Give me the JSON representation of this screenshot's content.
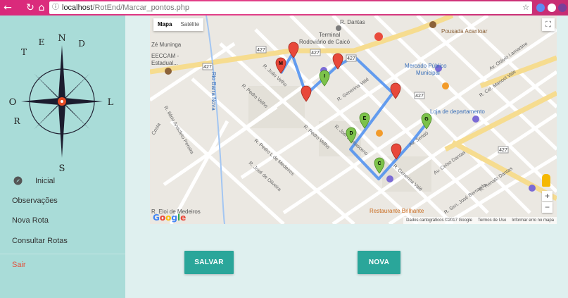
{
  "browser": {
    "url_host": "localhost",
    "url_path": "/RotEnd/Marcar_pontos.php"
  },
  "sidebar": {
    "logo_letters": {
      "n": "N",
      "e": "E",
      "s": "S",
      "o": "O",
      "l": "L",
      "r": "R",
      "t": "T",
      "d": "D"
    },
    "items": [
      {
        "label": "Inicial",
        "icon": "compass-icon"
      },
      {
        "label": "Observações"
      },
      {
        "label": "Nova Rota"
      },
      {
        "label": "Consultar Rotas"
      },
      {
        "label": "Sair"
      }
    ],
    "colors": {
      "background": "#a9dcd8",
      "sair": "#e2513c"
    }
  },
  "map": {
    "type_buttons": [
      "Mapa",
      "Satélite"
    ],
    "selected_type": "Mapa",
    "labels": {
      "terminal": "Terminal",
      "rodoviario": "Rodoviário de Caicó",
      "ze_muninga": "Zé Muninga",
      "eeccam": "EECCAM -",
      "estadual": "Estadual...",
      "rio": "Rio Barra Nova",
      "mercado1": "Mercado Público",
      "mercado2": "Municipal",
      "pousada": "Pousada Acantoar",
      "loja": "Loja de departamento",
      "restaurante": "Restaurante Brilhante",
      "eloi": "R. Eloi de Medeiros",
      "dantas": "R. Dantas",
      "pedro_velho1": "R. Pedro Velho",
      "pedro_velho2": "R. Pedro Velho",
      "joao_velho": "R. João Velho",
      "pedro_medeiros": "R. Pedro L de Medeiros",
      "jose_oliveira": "R. José de Oliveira",
      "generina": "R. Generina Valé",
      "generina2": "R. Generina Valé",
      "joel": "R. Joel Damasceno",
      "celso": "Av. Celso Dantas",
      "seridó": "Av. Seridó",
      "renato": "R. Renato Dantas",
      "teofilo": "R. Sen. José Bernardo",
      "lamartine": "Av. Otávio Lamartine",
      "cel_manoel": "R. Cel. Manoel Vale",
      "anacio": "R. Ilário Anacleto Pereira",
      "costa": "Costa",
      "route_327": "427",
      "route_428": "427"
    },
    "markers": [
      {
        "label": "M",
        "color": "red"
      },
      {
        "label": "",
        "color": "red"
      },
      {
        "label": "",
        "color": "red"
      },
      {
        "label": "I",
        "color": "green"
      },
      {
        "label": "",
        "color": "red"
      },
      {
        "label": "",
        "color": "red"
      },
      {
        "label": "E",
        "color": "green"
      },
      {
        "label": "D",
        "color": "green"
      },
      {
        "label": "G",
        "color": "green"
      },
      {
        "label": "",
        "color": "red"
      },
      {
        "label": "C",
        "color": "green"
      }
    ],
    "footer": {
      "data": "Dados cartográficos ©2017 Google",
      "terms": "Termos de Uso",
      "report": "Informar erro no mapa"
    },
    "logo": "Google",
    "zoom_in": "+",
    "zoom_out": "−"
  },
  "actions": {
    "save": "SALVAR",
    "new": "NOVA",
    "button_color": "#2aa69a"
  }
}
